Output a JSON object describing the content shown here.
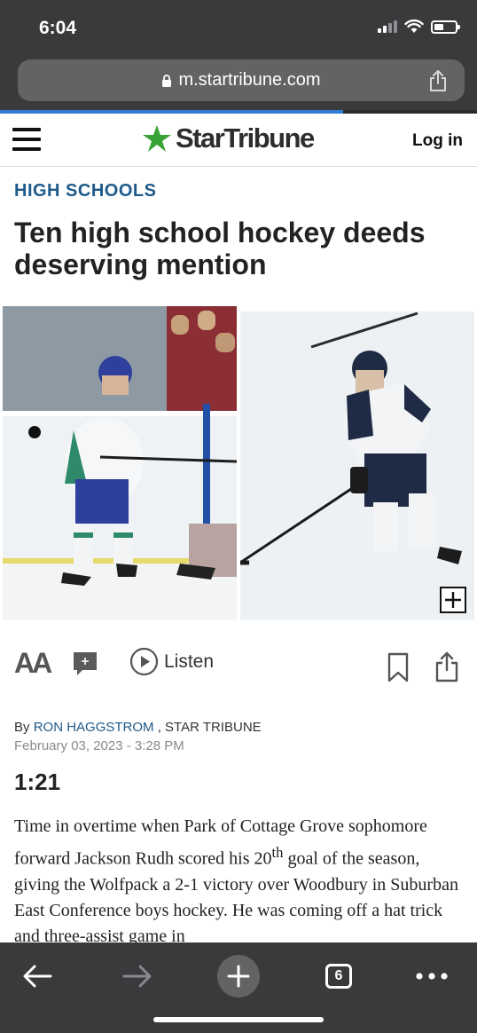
{
  "status_bar": {
    "time": "6:04"
  },
  "browser": {
    "url": "m.startribune.com",
    "load_progress": 0.72,
    "tab_count": "6"
  },
  "site_header": {
    "logo_text": "StarTribune",
    "login_label": "Log in",
    "brand_color": "#3aa335"
  },
  "article": {
    "kicker": "HIGH SCHOOLS",
    "headline": "Ten high school hockey deeds deserving mention",
    "photo_left_alt": "Hockey player in blue and white uniform",
    "photo_right_alt": "Hockey player in navy and white uniform",
    "byline_prefix": "By",
    "author": "RON HAGGSTROM",
    "outlet": ", STAR TRIBUNE",
    "date": "February 03, 2023 - 3:28 PM",
    "stat": "1:21",
    "body_before_sup": "Time in overtime when Park of Cottage Grove sophomore forward Jackson Rudh scored his 20",
    "body_sup": "th",
    "body_after_sup": " goal of the season, giving the Wolfpack a 2-1 victory over Woodbury in Suburban East Conference boys hockey. He was coming off a hat trick and three-assist game in"
  },
  "toolbar": {
    "text_size_label": "AA",
    "listen_label": "Listen"
  },
  "icons": {
    "accent": "#1e5a8a"
  }
}
